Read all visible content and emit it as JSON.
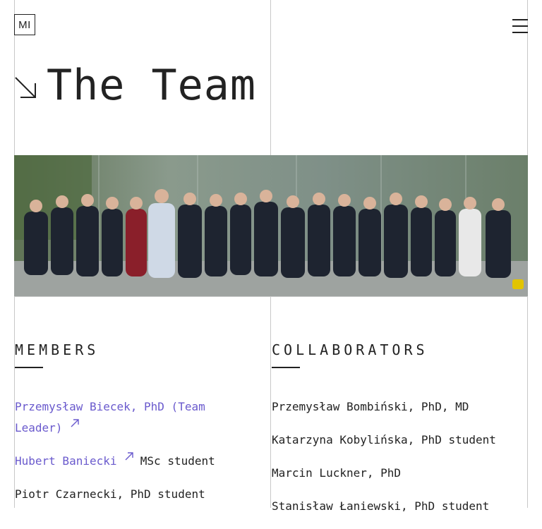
{
  "header": {
    "logo_text": "MI",
    "menu_icon": "hamburger-menu-icon"
  },
  "hero": {
    "arrow_icon": "arrow-down-right-icon",
    "title": "The Team"
  },
  "photo": {
    "description_icon": "team-photo"
  },
  "members": {
    "heading": "MEMBERS",
    "items": [
      {
        "name_line1": "Przemysław Biecek, PhD (Team",
        "name_line2": "Leader)",
        "role": "",
        "is_link": true
      },
      {
        "name": "Hubert Baniecki",
        "role": " MSc student",
        "is_link": true
      },
      {
        "name": "Piotr Czarnecki, PhD student",
        "role": "",
        "is_link": false
      }
    ]
  },
  "collaborators": {
    "heading": "COLLABORATORS",
    "items": [
      "Przemysław Bombiński, PhD, MD",
      "Katarzyna Kobylińska, PhD student",
      "Marcin Luckner, PhD",
      "Stanisław Łaniewski, PhD student"
    ]
  },
  "colors": {
    "link": "#6a5acd",
    "text": "#222222",
    "grid_line": "#c8c8c8"
  }
}
